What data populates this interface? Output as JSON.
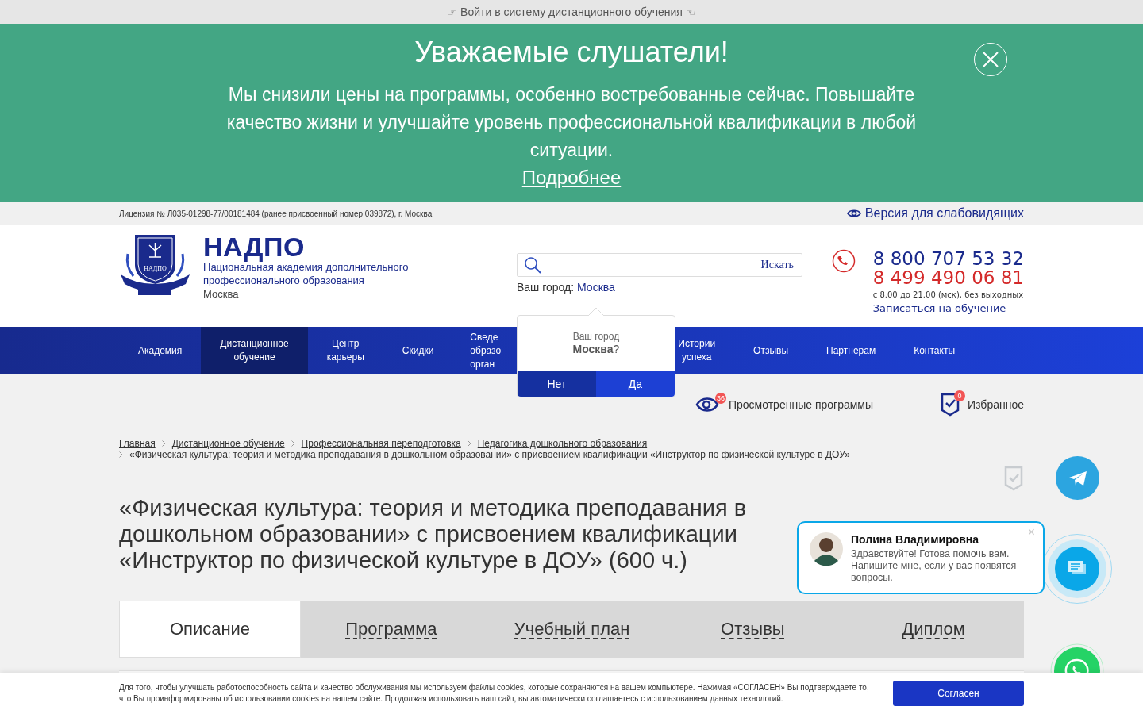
{
  "top_link": "☞ Войти в систему дистанционного обучения ☜",
  "banner": {
    "title": "Уважаемые слушатели!",
    "text": "Мы снизили цены на программы, особенно востребованные сейчас. Повышайте качество жизни и улучшайте уровень профессиональной квалификации в любой ситуации.",
    "link": "Подробнее"
  },
  "license": "Лицензия № Л035-01298-77/00181484 (ранее присвоенный номер 039872), г. Москва",
  "vision_link": "Версия для слабовидящих",
  "logo": {
    "emblem_text": "НАДПО",
    "name": "НАДПО",
    "subtitle": "Национальная академия дополнительного профессионального образования",
    "city": "Москва"
  },
  "search": {
    "button": "Искать",
    "city_label": "Ваш город:",
    "city": "Москва"
  },
  "contacts": {
    "phones": [
      {
        "number": "8 800 707 53 32",
        "color": "#1a2a8c"
      },
      {
        "number": "8 499 490 06 81",
        "color": "#d42a2a"
      }
    ],
    "hours": "с 8.00 до 21.00 (мск), без выходных",
    "signup": "Записаться на обучение"
  },
  "city_popup": {
    "label": "Ваш город",
    "city": "Москва",
    "question": "?",
    "buttons": [
      "Нет",
      "Да"
    ]
  },
  "nav": [
    {
      "label": "Академия",
      "selected": false
    },
    {
      "label": "Дистанционное обучение",
      "selected": true
    },
    {
      "label": "Центр карьеры",
      "selected": false
    },
    {
      "label": "Скидки",
      "selected": false
    },
    {
      "label": "Сведе\nобразо\nорган",
      "selected": false,
      "kind": "cut"
    },
    {
      "label": "Истории успеха",
      "selected": false
    },
    {
      "label": "Отзывы",
      "selected": false
    },
    {
      "label": "Партнерам",
      "selected": false
    },
    {
      "label": "Контакты",
      "selected": false
    }
  ],
  "tools": [
    {
      "label": "Просмотренные программы",
      "count": "36",
      "kind": "viewed"
    },
    {
      "label": "Избранное",
      "count": "0",
      "kind": "favorites"
    }
  ],
  "breadcrumbs": {
    "links": [
      "Главная",
      "Дистанционное обучение",
      "Профессиональная переподготовка",
      "Педагогика дошкольного образования"
    ],
    "current": "«Физическая культура: теория и методика преподавания в дошкольном образовании» с присвоением квалификации «Инструктор по физической культуре в ДОУ»"
  },
  "title": "«Физическая культура: теория и методика преподавания в дошкольном образовании» с присвоением квалификации «Инструктор по физической культуре в ДОУ» (600 ч.)",
  "tabs": [
    {
      "label": "Описание",
      "selected": true
    },
    {
      "label": "Программа",
      "selected": false
    },
    {
      "label": "Учебный план",
      "selected": false
    },
    {
      "label": "Отзывы",
      "selected": false
    },
    {
      "label": "Диплом",
      "selected": false
    }
  ],
  "chat": {
    "name": "Полина Владимировна",
    "message": "Здравствуйте! Готова помочь вам. Напишите мне, если у вас появятся вопросы.",
    "close": "×"
  },
  "cookie": {
    "text": "Для того, чтобы улучшать работоспособность сайта и качество обслуживания мы используем файлы cookies, которые сохраняются на вашем компьютере. Нажимая «СОГЛАСЕН» Вы подтверждаете то, что Вы проинформированы об использовании cookies на нашем сайте. Продолжая использовать наш сайт, вы автоматически соглашаетесь с использованием данных технологий.",
    "button": "Согласен"
  }
}
